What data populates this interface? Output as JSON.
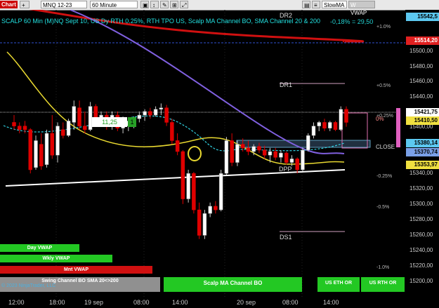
{
  "toolbar": {
    "chart_label": "Chart",
    "instrument": "MNQ 12-23",
    "interval": "60 Minute",
    "indicator_select": "SlowMA",
    "vwap_label": "W VWAP"
  },
  "chart_title": "SCALP 60 Min (M)NQ Sept 10, US Dy RTH 0.25%, RTH TPO US, Scalp MA Channel BO, SMA Channel 20 & 200",
  "rr_label": "-0,18% = 29,50",
  "pct_levels": [
    "+1.0%",
    "+0.5%",
    "+0.25%",
    "-0.25%",
    "-0.5%",
    "-1.0%"
  ],
  "level_labels": {
    "dr2": "DR2",
    "dr1": "DR1",
    "close": "CLOSE",
    "dpp": "DPP",
    "ds1": "DS1",
    "zero": "0%"
  },
  "price_ticks": [
    "15500,00",
    "15480,00",
    "15460,00",
    "15440,00",
    "15400,00",
    "15340,00",
    "15320,00",
    "15300,00",
    "15280,00",
    "15260,00",
    "15240,00",
    "15220,00",
    "15200,00"
  ],
  "price_tags": {
    "top": "15542,5",
    "red": "15514,20",
    "white": "15421,75",
    "yellow1": "15410,50",
    "blue1": "15380,14",
    "blue2": "15370,74",
    "yellow2": "15353,97"
  },
  "colors": {
    "red_tag": "#e02020",
    "white_tag": "#ffffff",
    "yellow_tag": "#f0e040",
    "blue_tag": "#5cc8f0",
    "cyan_tag": "#40c0d0"
  },
  "time_labels": [
    "12:00",
    "18:00",
    "19 sep",
    "08:00",
    "14:00",
    "20 sep",
    "08:00",
    "14:00"
  ],
  "left_buttons": {
    "day": "Day VWAP",
    "wkly": "Wkly VWAP",
    "mnt": "Mnt VWAP",
    "swing": "Swing Channel BO SMA 20<>200"
  },
  "bottom_buttons": {
    "scalp": "Scalp MA Channel BO",
    "eth": "US ETH OR",
    "rth": "US RTH OR"
  },
  "copyright": "© 2023 NinjaTrader, LLC",
  "annotation": {
    "value": "11,25",
    "count": "1"
  },
  "chart_data": {
    "type": "candlestick",
    "title": "SCALP 60 Min (M)NQ Sept 10, US Dy RTH 0.25%, RTH TPO US, Scalp MA Channel BO, SMA Channel 20 & 200",
    "ylim": [
      15190,
      15550
    ],
    "candles": [
      {
        "o": 15410,
        "h": 15420,
        "l": 15400,
        "c": 15405
      },
      {
        "o": 15405,
        "h": 15410,
        "l": 15395,
        "c": 15400
      },
      {
        "o": 15405,
        "h": 15412,
        "l": 15395,
        "c": 15400
      },
      {
        "o": 15400,
        "h": 15402,
        "l": 15340,
        "c": 15345
      },
      {
        "o": 15348,
        "h": 15392,
        "l": 15345,
        "c": 15385
      },
      {
        "o": 15380,
        "h": 15395,
        "l": 15345,
        "c": 15350
      },
      {
        "o": 15352,
        "h": 15400,
        "l": 15348,
        "c": 15395
      },
      {
        "o": 15395,
        "h": 15420,
        "l": 15360,
        "c": 15365
      },
      {
        "o": 15365,
        "h": 15410,
        "l": 15355,
        "c": 15405
      },
      {
        "o": 15400,
        "h": 15410,
        "l": 15388,
        "c": 15392
      },
      {
        "o": 15392,
        "h": 15415,
        "l": 15390,
        "c": 15412
      },
      {
        "o": 15410,
        "h": 15440,
        "l": 15400,
        "c": 15432
      },
      {
        "o": 15430,
        "h": 15440,
        "l": 15400,
        "c": 15405
      },
      {
        "o": 15405,
        "h": 15425,
        "l": 15395,
        "c": 15400
      },
      {
        "o": 15400,
        "h": 15438,
        "l": 15398,
        "c": 15432
      },
      {
        "o": 15432,
        "h": 15435,
        "l": 15412,
        "c": 15415
      },
      {
        "o": 15415,
        "h": 15425,
        "l": 15410,
        "c": 15420
      },
      {
        "o": 15420,
        "h": 15425,
        "l": 15400,
        "c": 15405
      },
      {
        "o": 15405,
        "h": 15425,
        "l": 15400,
        "c": 15420
      },
      {
        "o": 15420,
        "h": 15425,
        "l": 15398,
        "c": 15402
      },
      {
        "o": 15402,
        "h": 15418,
        "l": 15395,
        "c": 15405
      },
      {
        "o": 15405,
        "h": 15415,
        "l": 15398,
        "c": 15412
      },
      {
        "o": 15412,
        "h": 15418,
        "l": 15402,
        "c": 15415
      },
      {
        "o": 15415,
        "h": 15425,
        "l": 15410,
        "c": 15420
      },
      {
        "o": 15420,
        "h": 15428,
        "l": 15412,
        "c": 15425
      },
      {
        "o": 15425,
        "h": 15430,
        "l": 15415,
        "c": 15420
      },
      {
        "o": 15420,
        "h": 15432,
        "l": 15418,
        "c": 15428
      },
      {
        "o": 15428,
        "h": 15436,
        "l": 15420,
        "c": 15430
      },
      {
        "o": 15430,
        "h": 15434,
        "l": 15405,
        "c": 15410
      },
      {
        "o": 15410,
        "h": 15415,
        "l": 15380,
        "c": 15385
      },
      {
        "o": 15385,
        "h": 15395,
        "l": 15365,
        "c": 15370
      },
      {
        "o": 15370,
        "h": 15372,
        "l": 15298,
        "c": 15305
      },
      {
        "o": 15305,
        "h": 15345,
        "l": 15300,
        "c": 15340
      },
      {
        "o": 15340,
        "h": 15342,
        "l": 15285,
        "c": 15290
      },
      {
        "o": 15290,
        "h": 15300,
        "l": 15250,
        "c": 15255
      },
      {
        "o": 15255,
        "h": 15290,
        "l": 15250,
        "c": 15285
      },
      {
        "o": 15285,
        "h": 15300,
        "l": 15280,
        "c": 15295
      },
      {
        "o": 15295,
        "h": 15302,
        "l": 15285,
        "c": 15290
      },
      {
        "o": 15290,
        "h": 15345,
        "l": 15288,
        "c": 15340
      },
      {
        "o": 15340,
        "h": 15390,
        "l": 15338,
        "c": 15385
      },
      {
        "o": 15385,
        "h": 15395,
        "l": 15350,
        "c": 15355
      },
      {
        "o": 15355,
        "h": 15385,
        "l": 15350,
        "c": 15380
      },
      {
        "o": 15380,
        "h": 15388,
        "l": 15370,
        "c": 15375
      },
      {
        "o": 15375,
        "h": 15385,
        "l": 15365,
        "c": 15370
      },
      {
        "o": 15370,
        "h": 15380,
        "l": 15365,
        "c": 15377
      },
      {
        "o": 15377,
        "h": 15382,
        "l": 15368,
        "c": 15372
      },
      {
        "o": 15372,
        "h": 15378,
        "l": 15360,
        "c": 15365
      },
      {
        "o": 15365,
        "h": 15375,
        "l": 15355,
        "c": 15370
      },
      {
        "o": 15370,
        "h": 15375,
        "l": 15358,
        "c": 15362
      },
      {
        "o": 15362,
        "h": 15372,
        "l": 15355,
        "c": 15368
      },
      {
        "o": 15368,
        "h": 15370,
        "l": 15352,
        "c": 15355
      },
      {
        "o": 15355,
        "h": 15365,
        "l": 15350,
        "c": 15360
      },
      {
        "o": 15360,
        "h": 15362,
        "l": 15340,
        "c": 15345
      },
      {
        "o": 15345,
        "h": 15375,
        "l": 15343,
        "c": 15372
      },
      {
        "o": 15372,
        "h": 15395,
        "l": 15370,
        "c": 15392
      },
      {
        "o": 15392,
        "h": 15410,
        "l": 15388,
        "c": 15405
      },
      {
        "o": 15405,
        "h": 15412,
        "l": 15398,
        "c": 15410
      },
      {
        "o": 15410,
        "h": 15415,
        "l": 15398,
        "c": 15402
      },
      {
        "o": 15402,
        "h": 15412,
        "l": 15398,
        "c": 15410
      },
      {
        "o": 15410,
        "h": 15412,
        "l": 15398,
        "c": 15400
      },
      {
        "o": 15400,
        "h": 15432,
        "l": 15398,
        "c": 15428
      },
      {
        "o": 15428,
        "h": 15432,
        "l": 15404,
        "c": 15410
      }
    ]
  }
}
